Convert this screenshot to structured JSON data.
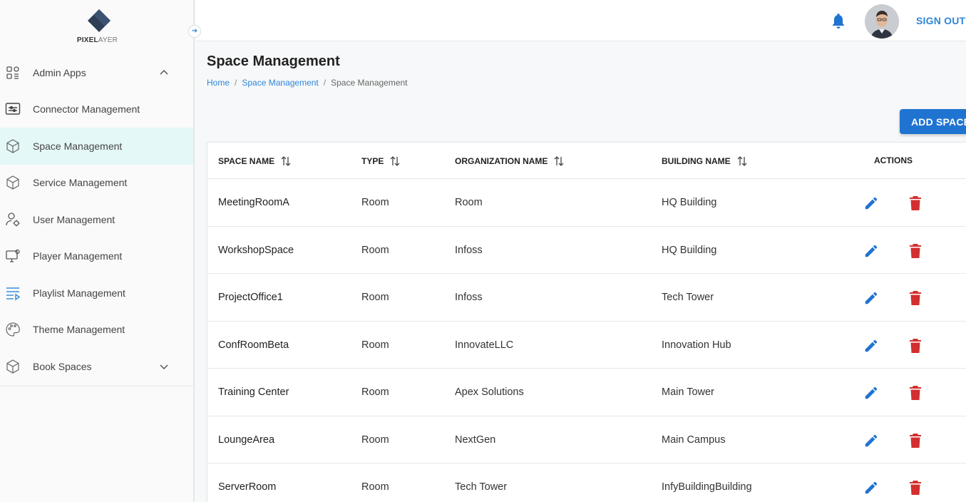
{
  "brand": {
    "logo_bold": "PIXEL",
    "logo_light": "AYER"
  },
  "sidebar": {
    "items": [
      {
        "label": "Admin Apps",
        "icon": "apps-icon"
      },
      {
        "label": "Connector Management",
        "icon": "connector-icon"
      },
      {
        "label": "Space Management",
        "icon": "space-icon"
      },
      {
        "label": "Service Management",
        "icon": "service-icon"
      },
      {
        "label": "User Management",
        "icon": "user-icon"
      },
      {
        "label": "Player Management",
        "icon": "player-icon"
      },
      {
        "label": "Playlist Management",
        "icon": "playlist-icon"
      },
      {
        "label": "Theme Management",
        "icon": "theme-icon"
      },
      {
        "label": "Book Spaces",
        "icon": "book-icon"
      }
    ],
    "active_label": "Space Management"
  },
  "topbar": {
    "signout_label": "SIGN OUT"
  },
  "page": {
    "title": "Space Management",
    "breadcrumb": [
      "Home",
      "Space Management",
      "Space Management"
    ],
    "add_button": "ADD SPACE"
  },
  "table": {
    "headers": [
      "SPACE NAME",
      "TYPE",
      "ORGANIZATION NAME",
      "BUILDING NAME",
      "ACTIONS"
    ],
    "rows": [
      {
        "space": "MeetingRoomA",
        "type": "Room",
        "org": "Room",
        "building": "HQ Building"
      },
      {
        "space": "WorkshopSpace",
        "type": "Room",
        "org": "Infoss",
        "building": "HQ Building"
      },
      {
        "space": "ProjectOffice1",
        "type": "Room",
        "org": "Infoss",
        "building": "Tech Tower"
      },
      {
        "space": "ConfRoomBeta",
        "type": "Room",
        "org": "InnovateLLC",
        "building": "Innovation Hub"
      },
      {
        "space": "Training Center",
        "type": "Room",
        "org": "Apex Solutions",
        "building": "Main Tower"
      },
      {
        "space": "LoungeArea",
        "type": "Room",
        "org": "NextGen",
        "building": "Main Campus"
      },
      {
        "space": "ServerRoom",
        "type": "Room",
        "org": "Tech Tower",
        "building": "InfyBuildingBuilding"
      }
    ]
  },
  "colors": {
    "accent": "#2f86d8",
    "button": "#1f73d1",
    "delete": "#d32f2f",
    "active_bg": "#e5f8f8"
  }
}
